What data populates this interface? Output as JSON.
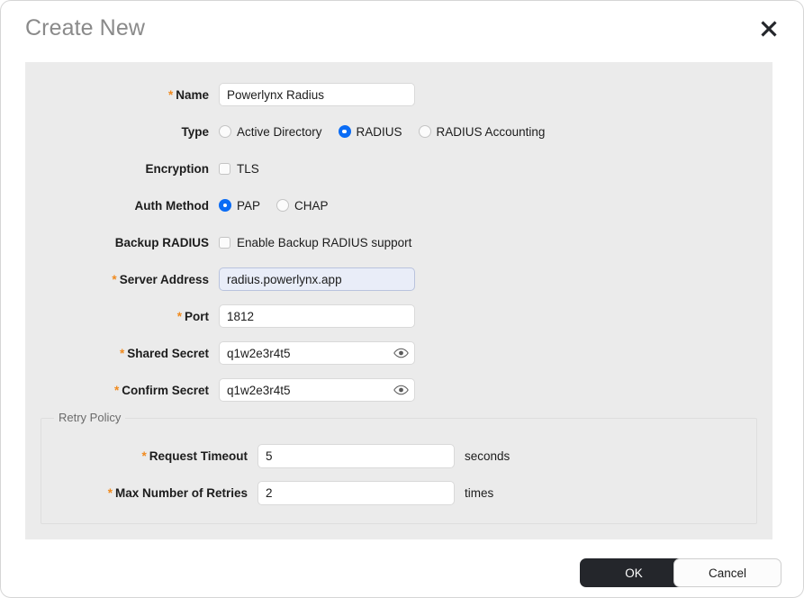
{
  "dialog": {
    "title": "Create New",
    "close_icon": "close-x-icon"
  },
  "form": {
    "rows": {
      "name": {
        "label": "Name",
        "required": true,
        "value": "Powerlynx Radius",
        "placeholder": ""
      },
      "type": {
        "label": "Type",
        "required": false,
        "options": [
          {
            "label": "Active Directory",
            "selected": false
          },
          {
            "label": "RADIUS",
            "selected": true
          },
          {
            "label": "RADIUS Accounting",
            "selected": false
          }
        ]
      },
      "encryption": {
        "label": "Encryption",
        "required": false,
        "options": [
          {
            "label": "TLS",
            "checked": false
          }
        ]
      },
      "auth_method": {
        "label": "Auth Method",
        "required": false,
        "options": [
          {
            "label": "PAP",
            "selected": true
          },
          {
            "label": "CHAP",
            "selected": false
          }
        ]
      },
      "backup_radius": {
        "label": "Backup RADIUS",
        "required": false,
        "options": [
          {
            "label": "Enable Backup RADIUS support",
            "checked": false
          }
        ]
      },
      "server_address": {
        "label": "Server Address",
        "required": true,
        "value": "radius.powerlynx.app",
        "placeholder": "",
        "focused": true
      },
      "port": {
        "label": "Port",
        "required": true,
        "value": "1812",
        "placeholder": ""
      },
      "shared_secret": {
        "label": "Shared Secret",
        "required": true,
        "value": "q1w2e3r4t5",
        "placeholder": "",
        "reveal_icon": "eye-icon"
      },
      "confirm_secret": {
        "label": "Confirm Secret",
        "required": true,
        "value": "q1w2e3r4t5",
        "placeholder": "",
        "reveal_icon": "eye-icon"
      }
    },
    "retry_policy": {
      "legend": "Retry Policy",
      "request_timeout": {
        "label": "Request Timeout",
        "required": true,
        "value": "5",
        "unit": "seconds"
      },
      "max_retries": {
        "label": "Max Number of Retries",
        "required": true,
        "value": "2",
        "unit": "times"
      }
    }
  },
  "footer": {
    "ok_label": "OK",
    "cancel_label": "Cancel"
  },
  "colors": {
    "accent_blue": "#0a6cf5",
    "required_orange": "#f08a1e",
    "panel_gray": "#ebebeb",
    "primary_button": "#24262b",
    "focus_fill": "#e9edf8"
  }
}
